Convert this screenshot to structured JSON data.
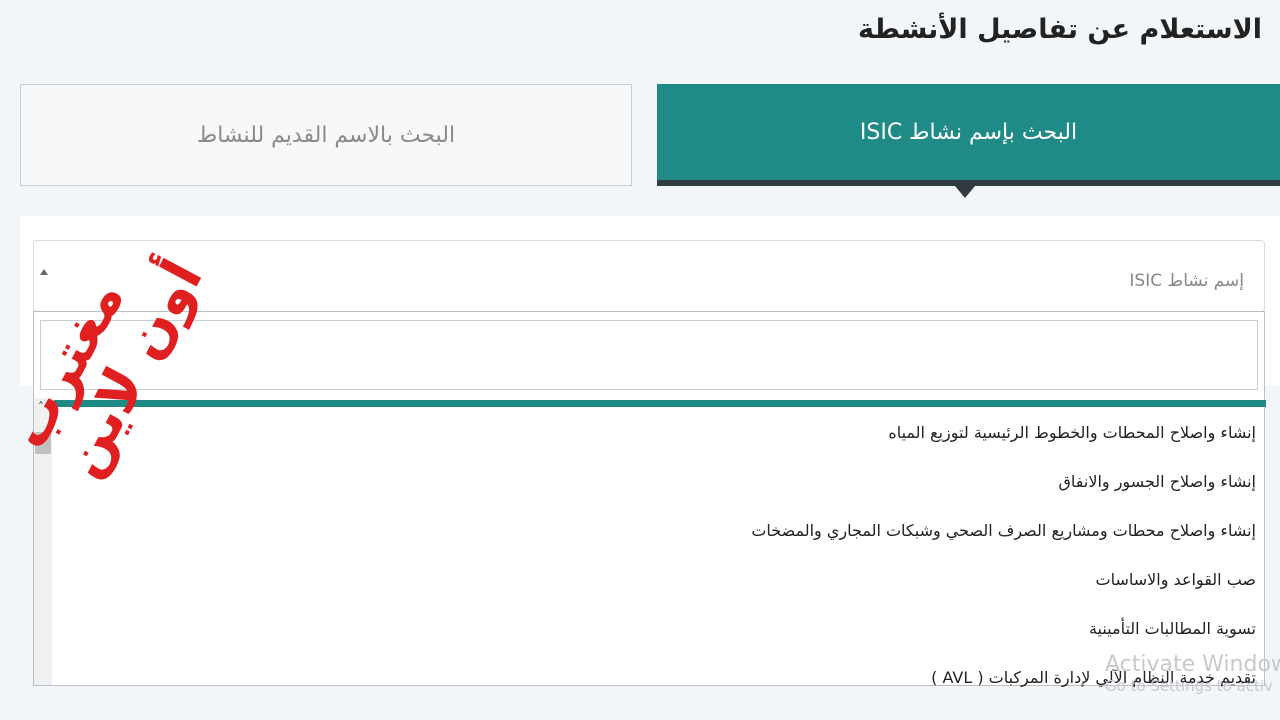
{
  "page": {
    "title": "الاستعلام عن تفاصيل الأنشطة"
  },
  "tabs": [
    {
      "label": "البحث بإسم نشاط ISIC",
      "active": true
    },
    {
      "label": "البحث بالاسم القديم للنشاط",
      "active": false
    }
  ],
  "select": {
    "value": "إسم نشاط ISIC",
    "search_value": ""
  },
  "options": [
    "إنشاء واصلاح المحطات والخطوط الرئيسية لتوزيع المياه",
    "إنشاء واصلاح الجسور والانفاق",
    "إنشاء واصلاح محطات ومشاريع الصرف الصحي وشبكات المجاري والمضخات",
    "صب القواعد والاساسات",
    "تسوية المطالبات التأمينية",
    "تقديم خدمة النظام الآلي لإدارة المركبات ( AVL )"
  ],
  "watermark": {
    "line1": "مغترب",
    "line2": "أون لاين"
  },
  "activation": {
    "title": "Activate Window",
    "subtitle": "Go to Settings to activ"
  },
  "colors": {
    "accent": "#1f8a86",
    "tab_shadow": "#2f3b40",
    "watermark": "#e02020"
  },
  "icons": {
    "caret": "caret-up-icon",
    "scroll_up": "chevron-up-icon"
  }
}
